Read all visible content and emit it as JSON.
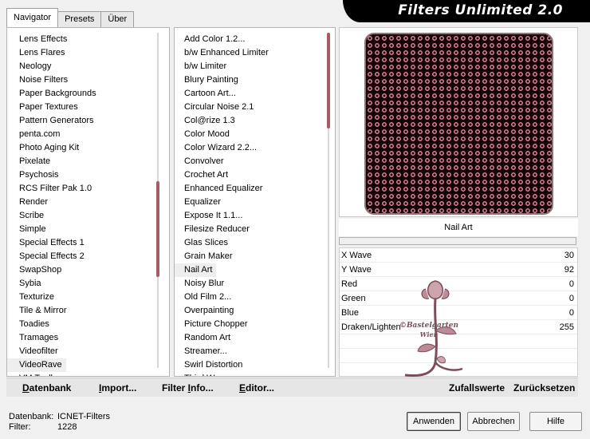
{
  "tabs": [
    {
      "label": "Navigator",
      "active": true
    },
    {
      "label": "Presets",
      "active": false
    },
    {
      "label": "Über",
      "active": false
    }
  ],
  "app_title": "Filters Unlimited 2.0",
  "categories": {
    "items": [
      "Lens Effects",
      "Lens Flares",
      "Neology",
      "Noise Filters",
      "Paper Backgrounds",
      "Paper Textures",
      "Pattern Generators",
      "penta.com",
      "Photo Aging Kit",
      "Pixelate",
      "Psychosis",
      "RCS Filter Pak 1.0",
      "Render",
      "Scribe",
      "Simple",
      "Special Effects 1",
      "Special Effects 2",
      "SwapShop",
      "Sybia",
      "Texturize",
      "Tile & Mirror",
      "Toadies",
      "Tramages",
      "Videofilter",
      "VideoRave",
      "VM Toolbox"
    ],
    "selected": "VideoRave",
    "scroll_position": 0.62
  },
  "filters": {
    "items": [
      "Add Color 1.2...",
      "b/w Enhanced Limiter",
      "b/w Limiter",
      "Blury Painting",
      "Cartoon Art...",
      "Circular Noise 2.1",
      "Col@rize 1.3",
      "Color Mood",
      "Color Wizard 2.2...",
      "Convolver",
      "Crochet Art",
      "Enhanced Equalizer",
      "Equalizer",
      "Expose It 1.1...",
      "Filesize Reducer",
      "Glas Slices",
      "Grain Maker",
      "Nail Art",
      "Noisy Blur",
      "Old Film 2...",
      "Overpainting",
      "Picture Chopper",
      "Random Art",
      "Streamer...",
      "Swirl Distortion",
      "Third Wave"
    ],
    "selected": "Nail Art",
    "scroll_position": 0.0
  },
  "preview": {
    "filter_name": "Nail Art",
    "progress": 0.0
  },
  "params": [
    {
      "label": "X Wave",
      "value": "30"
    },
    {
      "label": "Y Wave",
      "value": "92"
    },
    {
      "label": "Red",
      "value": "0"
    },
    {
      "label": "Green",
      "value": "0"
    },
    {
      "label": "Blue",
      "value": "0"
    },
    {
      "label": "Draken/Lighten",
      "value": "255"
    }
  ],
  "watermark": {
    "line1": "©Bastelgarten",
    "line2": "Wien"
  },
  "bottom_bar": {
    "datenbank": {
      "ul": "D",
      "rest": "atenbank"
    },
    "import": {
      "ul": "I",
      "rest": "mport..."
    },
    "filter_info": {
      "pre": "Filter ",
      "ul": "I",
      "rest": "nfo..."
    },
    "editor": {
      "ul": "E",
      "rest": "ditor..."
    },
    "zufallswerte": "Zufallswerte",
    "zuruecksetzen": "Zurücksetzen"
  },
  "status": {
    "db_label": "Datenbank:",
    "db_value": "ICNET-Filters",
    "filter_label": "Filter:",
    "filter_value": "1228"
  },
  "buttons": {
    "apply": "Anwenden",
    "cancel": "Abbrechen",
    "help": "Hilfe"
  },
  "colors": {
    "accent": "#a65b67",
    "banner": "#000000"
  }
}
